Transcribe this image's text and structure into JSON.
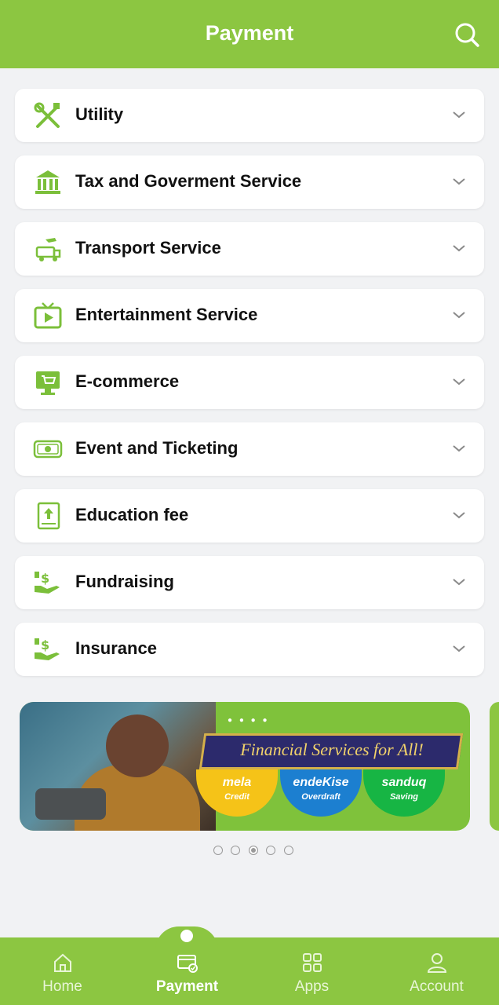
{
  "header": {
    "title": "Payment",
    "search_icon": "search-icon"
  },
  "categories": [
    {
      "label": "Utility",
      "icon": "tools-icon"
    },
    {
      "label": "Tax and Goverment Service",
      "icon": "government-building-icon"
    },
    {
      "label": "Transport Service",
      "icon": "transport-icon"
    },
    {
      "label": "Entertainment Service",
      "icon": "tv-icon"
    },
    {
      "label": "E-commerce",
      "icon": "shopping-cart-monitor-icon"
    },
    {
      "label": "Event and Ticketing",
      "icon": "ticket-icon"
    },
    {
      "label": "Education fee",
      "icon": "education-book-icon"
    },
    {
      "label": "Fundraising",
      "icon": "hand-money-icon"
    },
    {
      "label": "Insurance",
      "icon": "hand-money-icon"
    }
  ],
  "banner": {
    "headline": "Financial Services for All!",
    "products": [
      {
        "name": "mela",
        "subtitle": "Credit"
      },
      {
        "name": "endeKise",
        "subtitle": "Overdraft"
      },
      {
        "name": "sanduq",
        "subtitle": "Saving"
      }
    ],
    "page_count": 5,
    "active_page": 3
  },
  "bottom_nav": [
    {
      "label": "Home",
      "icon": "home-icon",
      "active": false
    },
    {
      "label": "Payment",
      "icon": "payment-card-icon",
      "active": true
    },
    {
      "label": "Apps",
      "icon": "apps-grid-icon",
      "active": false
    },
    {
      "label": "Account",
      "icon": "account-user-icon",
      "active": false
    }
  ],
  "colors": {
    "brand_green": "#8cc641",
    "background": "#f1f2f4"
  }
}
